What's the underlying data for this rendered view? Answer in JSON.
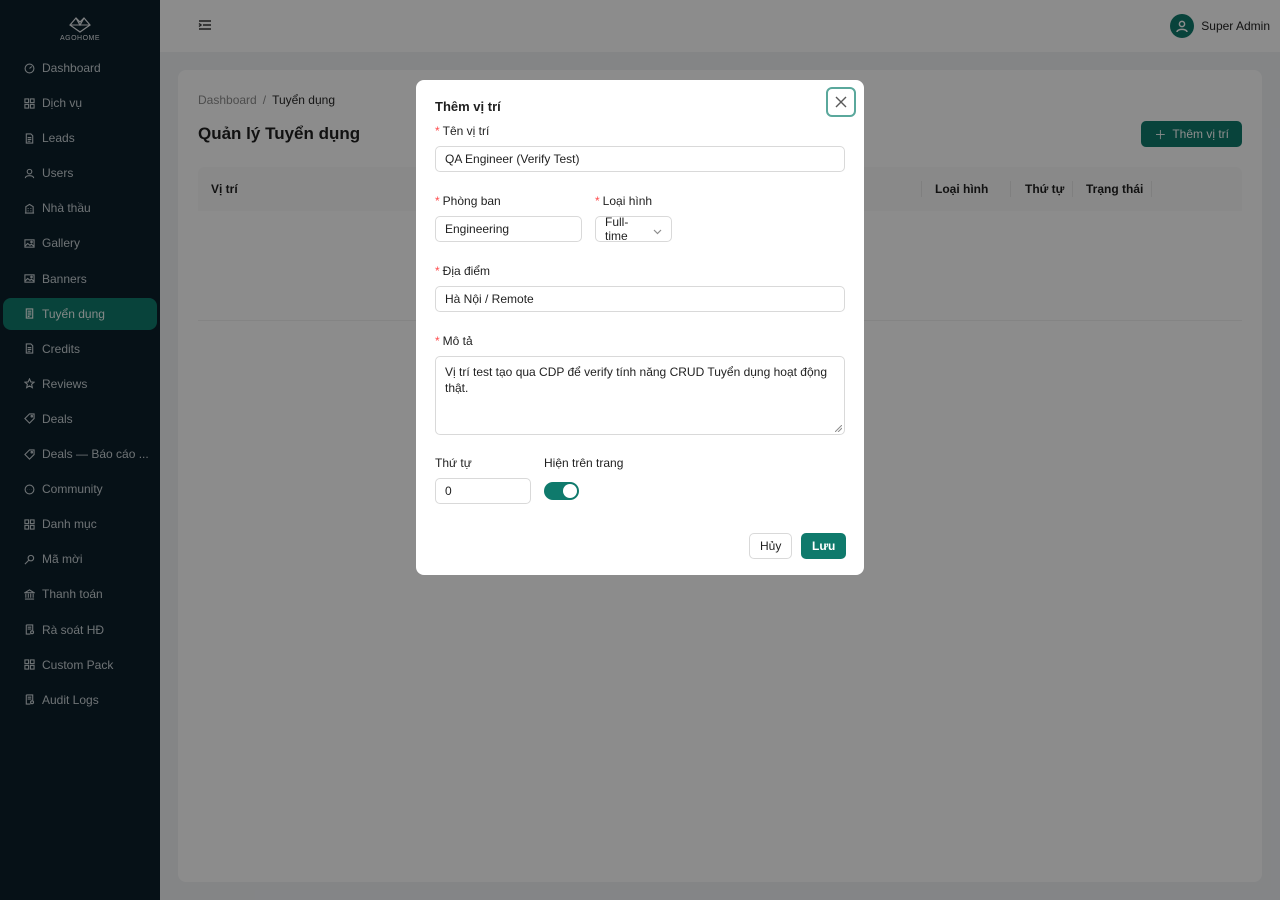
{
  "brand": {
    "name": "AGOHOME",
    "accent": "#0f7a6c",
    "sidebar_bg": "#0b1f2a"
  },
  "sidebar": {
    "items": [
      {
        "label": "Dashboard",
        "icon": "dashboard-icon"
      },
      {
        "label": "Dịch vụ",
        "icon": "grid-icon"
      },
      {
        "label": "Leads",
        "icon": "file-icon"
      },
      {
        "label": "Users",
        "icon": "user-icon"
      },
      {
        "label": "Nhà thầu",
        "icon": "building-icon"
      },
      {
        "label": "Gallery",
        "icon": "image-icon"
      },
      {
        "label": "Banners",
        "icon": "image-icon"
      },
      {
        "label": "Tuyển dụng",
        "icon": "document-icon",
        "active": true
      },
      {
        "label": "Credits",
        "icon": "file-icon"
      },
      {
        "label": "Reviews",
        "icon": "star-icon"
      },
      {
        "label": "Deals",
        "icon": "tag-icon"
      },
      {
        "label": "Deals — Báo cáo ...",
        "icon": "tag-icon"
      },
      {
        "label": "Community",
        "icon": "chat-icon"
      },
      {
        "label": "Danh mục",
        "icon": "grid-icon"
      },
      {
        "label": "Mã mời",
        "icon": "key-icon"
      },
      {
        "label": "Thanh toán",
        "icon": "bank-icon"
      },
      {
        "label": "Rà soát HĐ",
        "icon": "audit-icon"
      },
      {
        "label": "Custom Pack",
        "icon": "grid-icon"
      },
      {
        "label": "Audit Logs",
        "icon": "audit-icon"
      }
    ]
  },
  "header": {
    "user_name": "Super Admin"
  },
  "page": {
    "breadcrumb": [
      "Dashboard",
      "Tuyển dụng"
    ],
    "breadcrumb_sep": "/",
    "title": "Quản lý Tuyển dụng",
    "add_button": "Thêm vị trí",
    "table": {
      "columns": [
        "Vị trí",
        "Loại hình",
        "Thứ tự",
        "Trạng thái"
      ]
    }
  },
  "modal": {
    "title": "Thêm vị trí",
    "fields": {
      "name": {
        "label": "Tên vị trí",
        "value": "QA Engineer (Verify Test)"
      },
      "department": {
        "label": "Phòng ban",
        "value": "Engineering"
      },
      "type": {
        "label": "Loại hình",
        "value": "Full-time"
      },
      "location": {
        "label": "Địa điểm",
        "value": "Hà Nội / Remote"
      },
      "description": {
        "label": "Mô tả",
        "value": "Vị trí test tạo qua CDP để verify tính năng CRUD Tuyển dụng hoạt động thật."
      },
      "order": {
        "label": "Thứ tự",
        "value": "0"
      },
      "visible": {
        "label": "Hiện trên trang",
        "on": true
      }
    },
    "required_mark": "*",
    "cancel_label": "Hủy",
    "save_label": "Lưu"
  }
}
